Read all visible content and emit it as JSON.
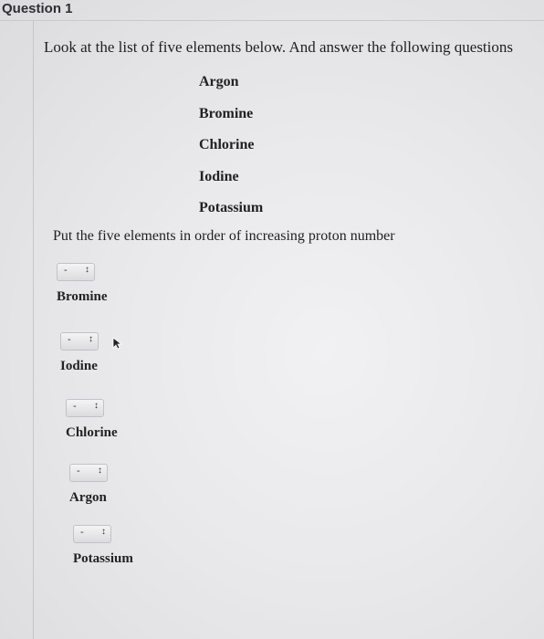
{
  "question": {
    "title": "Question 1",
    "intro": "Look at the list of five elements below. And answer the following questions",
    "elements": [
      "Argon",
      "Bromine",
      "Chlorine",
      "Iodine",
      "Potassium"
    ],
    "prompt": "Put the five elements in order of increasing proton number"
  },
  "answers": [
    {
      "select_value": "-",
      "label": "Bromine"
    },
    {
      "select_value": "-",
      "label": "Iodine"
    },
    {
      "select_value": "-",
      "label": "Chlorine"
    },
    {
      "select_value": "-",
      "label": "Argon"
    },
    {
      "select_value": "-",
      "label": "Potassium"
    }
  ],
  "icons": {
    "select_arrows": "up-down-chevron-icon",
    "cursor": "mouse-pointer-icon"
  }
}
